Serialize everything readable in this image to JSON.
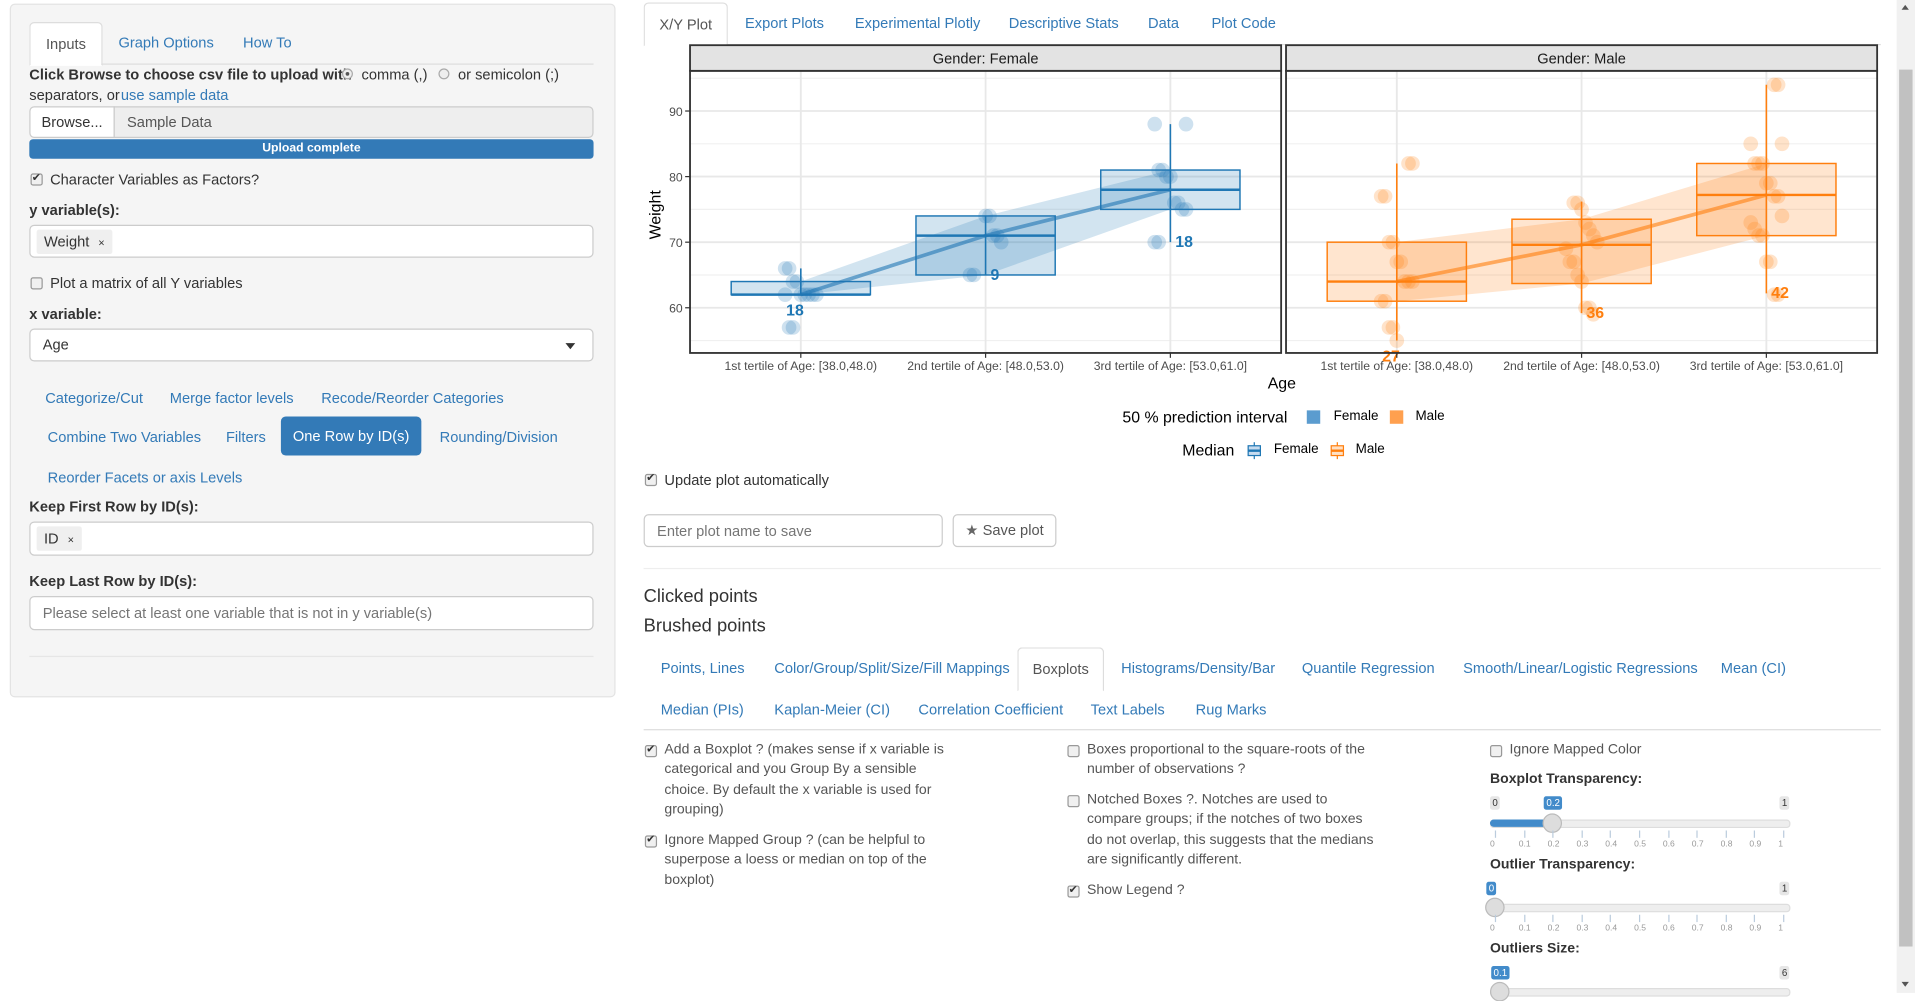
{
  "sidebar": {
    "tabs": [
      "Inputs",
      "Graph Options",
      "How To"
    ],
    "upload_prompt": "Click Browse to choose csv file to upload with",
    "separator_comma": "comma (,)",
    "separator_semicolon": "or semicolon (;)",
    "separators_text": "separators, or",
    "sample_link": "use sample data",
    "browse_label": "Browse...",
    "file_value": "Sample Data",
    "upload_status": "Upload complete",
    "char_factors_label": "Character Variables as Factors?",
    "char_factors_checked": true,
    "y_label": "y variable(s):",
    "y_tags": [
      "Weight"
    ],
    "matrix_label": "Plot a matrix of all Y variables",
    "matrix_checked": false,
    "x_label": "x variable:",
    "x_value": "Age",
    "pills": [
      "Categorize/Cut",
      "Merge factor levels",
      "Recode/Reorder Categories",
      "Combine Two Variables",
      "Filters",
      "One Row by ID(s)",
      "Rounding/Division",
      "Reorder Facets or axis Levels"
    ],
    "active_pill": "One Row by ID(s)",
    "keep_first_label": "Keep First Row by ID(s):",
    "keep_first_tags": [
      "ID"
    ],
    "keep_last_label": "Keep Last Row by ID(s):",
    "keep_last_placeholder": "Please select at least one variable that is not in y variable(s)",
    "remove_glyph": "×"
  },
  "main": {
    "tabs": [
      "X/Y Plot",
      "Export Plots",
      "Experimental Plotly",
      "Descriptive Stats",
      "Data",
      "Plot Code"
    ],
    "update_auto_label": "Update plot automatically",
    "update_auto_checked": true,
    "plot_name_placeholder": "Enter plot name to save",
    "save_plot_label": "Save plot",
    "save_icon": "star-icon",
    "clicked_points": "Clicked points",
    "brushed_points": "Brushed points",
    "sub_tabs_row1": [
      "Points, Lines",
      "Color/Group/Split/Size/Fill Mappings",
      "Boxplots",
      "Histograms/Density/Bar",
      "Quantile Regression",
      "Smooth/Linear/Logistic Regressions",
      "Mean (CI)"
    ],
    "sub_tabs_row2": [
      "Median (PIs)",
      "Kaplan-Meier (CI)",
      "Correlation Coefficient",
      "Text Labels",
      "Rug Marks"
    ],
    "active_sub_tab": "Boxplots",
    "options": {
      "add_boxplot": {
        "label": "Add a Boxplot ? (makes sense if x variable is categorical and you Group By a sensible choice. By default the x variable is used for grouping)",
        "checked": true
      },
      "ignore_group": {
        "label": "Ignore Mapped Group ? (can be helpful to superpose a loess or median on top of the boxplot)",
        "checked": true
      },
      "proportional": {
        "label": "Boxes proportional to the square-roots of the number of observations ?",
        "checked": false
      },
      "notched": {
        "label": "Notched Boxes ?. Notches are used to compare groups; if the notches of two boxes do not overlap, this suggests that the medians are significantly different.",
        "checked": false
      },
      "show_legend": {
        "label": "Show Legend ?",
        "checked": true
      },
      "ignore_color": {
        "label": "Ignore Mapped Color",
        "checked": false
      }
    },
    "sliders": [
      {
        "label": "Boxplot Transparency:",
        "min": "0",
        "max": "1",
        "value": 0.2,
        "value_label": "0.2",
        "ticks": [
          "0",
          "0.1",
          "0.2",
          "0.3",
          "0.4",
          "0.5",
          "0.6",
          "0.7",
          "0.8",
          "0.9",
          "1"
        ]
      },
      {
        "label": "Outlier Transparency:",
        "min": "0",
        "max": "1",
        "value": 0,
        "value_label": "0",
        "ticks": [
          "0",
          "0.1",
          "0.2",
          "0.3",
          "0.4",
          "0.5",
          "0.6",
          "0.7",
          "0.8",
          "0.9",
          "1"
        ]
      },
      {
        "label": "Outliers Size:",
        "min": "0",
        "max": "6",
        "value": 0.1,
        "value_label": "0.1"
      }
    ]
  },
  "chart_data": {
    "type": "boxplot",
    "facets": [
      "Gender: Female",
      "Gender: Male"
    ],
    "categories": [
      "1st tertile of Age: [38.0,48.0)",
      "2nd tertile of Age: [48.0,53.0)",
      "3rd tertile of Age: [53.0,61.0]"
    ],
    "xlabel": "Age",
    "ylabel": "Weight",
    "ylim": [
      53.1,
      96.1
    ],
    "yticks": [
      60,
      70,
      80,
      90
    ],
    "grid": true,
    "colors": {
      "Female": "#1f77b4",
      "Male": "#ff7f0e"
    },
    "series": [
      {
        "name": "Female",
        "boxes": [
          {
            "q1": 62,
            "median": 62,
            "q3": 64,
            "lower": 62,
            "upper": 66,
            "n": "18",
            "points": [
              66,
              66,
              64,
              64,
              62,
              62,
              62,
              62,
              62,
              62,
              57,
              57
            ]
          },
          {
            "q1": 65,
            "median": 71,
            "q3": 74,
            "lower": 65,
            "upper": 74,
            "n": "9",
            "points": [
              74,
              74,
              71,
              71,
              70,
              65,
              65
            ]
          },
          {
            "q1": 75,
            "median": 78,
            "q3": 81,
            "lower": 70,
            "upper": 88,
            "n": "18",
            "points": [
              88,
              88,
              81,
              81,
              80,
              80,
              76,
              76,
              75,
              75,
              70,
              70
            ]
          }
        ]
      },
      {
        "name": "Male",
        "boxes": [
          {
            "q1": 61,
            "median": 64,
            "q3": 70,
            "lower": 55,
            "upper": 82,
            "n": "27",
            "points": [
              82,
              82,
              77,
              77,
              70,
              70,
              67,
              67,
              64,
              64,
              64,
              61,
              61,
              57,
              57,
              55
            ]
          },
          {
            "q1": 63.7,
            "median": 69.6,
            "q3": 73.5,
            "lower": 59.2,
            "upper": 76.2,
            "n": "36",
            "points": [
              76,
              76,
              75,
              73,
              72,
              71,
              70,
              69,
              67,
              67,
              65,
              64,
              60,
              60,
              59
            ]
          },
          {
            "q1": 71,
            "median": 77.2,
            "q3": 82,
            "lower": 62.2,
            "upper": 94,
            "n": "42",
            "points": [
              94,
              94,
              85,
              85,
              82,
              82,
              82,
              79,
              79,
              77,
              77,
              74,
              73,
              72,
              71,
              71,
              67,
              67,
              62,
              62
            ]
          }
        ]
      }
    ],
    "legend": {
      "interval_title": "50 % prediction interval",
      "median_title": "Median",
      "entries": [
        "Female",
        "Male"
      ],
      "placement": "bottom"
    }
  }
}
